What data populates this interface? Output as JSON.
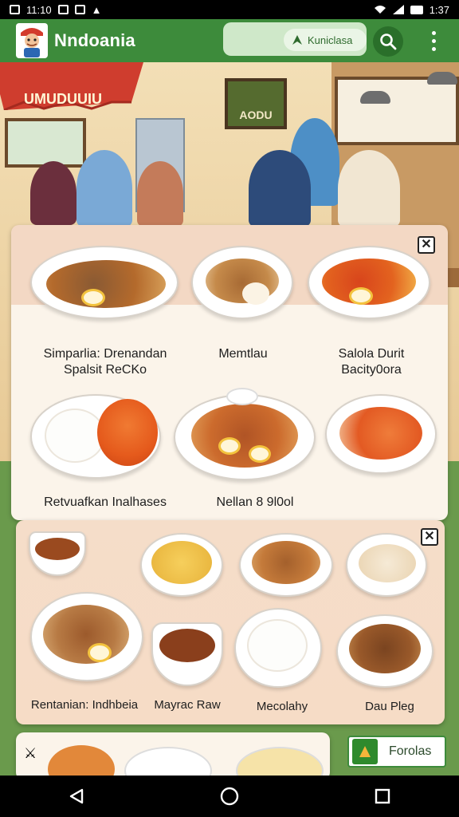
{
  "status_bar": {
    "time_left": "11:10",
    "time_right": "1:37"
  },
  "app_bar": {
    "title": "Nndoania",
    "location_label": "Kuniclasa",
    "icons": [
      "logo-mascot-icon",
      "location-icon",
      "search-icon",
      "more-vert-icon"
    ]
  },
  "hero": {
    "umbrella_text": "UMUDUUIU",
    "frame_text": "AODU"
  },
  "menu_card_1": {
    "dishes": [
      {
        "label_line1": "Simparlia: Drenandan",
        "label_line2": "Spalsit ReCKo"
      },
      {
        "label_line1": "Memtlau",
        "label_line2": ""
      },
      {
        "label_line1": "Salola Durit",
        "label_line2": "Bacity0ora"
      },
      {
        "label_line1": "Retvuafkan Inalhases",
        "label_line2": ""
      },
      {
        "label_line1": "",
        "label_line2": ""
      },
      {
        "label_line1": "Nellan 8 9l0ol",
        "label_line2": ""
      }
    ]
  },
  "menu_card_2": {
    "dishes": [
      {
        "label": "Rentanian: Indhbeia"
      },
      {
        "label": "Mayrac Raw"
      },
      {
        "label": "Mecolahy"
      },
      {
        "label": "Dau Pleg"
      }
    ]
  },
  "footer_chip": {
    "label": "Forolas"
  },
  "nav_bar": {
    "icons": [
      "back-icon",
      "home-icon",
      "recents-icon"
    ]
  },
  "colors": {
    "app_bar": "#3d8b3b",
    "accent_dark": "#2a6f2a",
    "card_bg": "#fbf1e6",
    "card_header": "#f3d8c4"
  }
}
